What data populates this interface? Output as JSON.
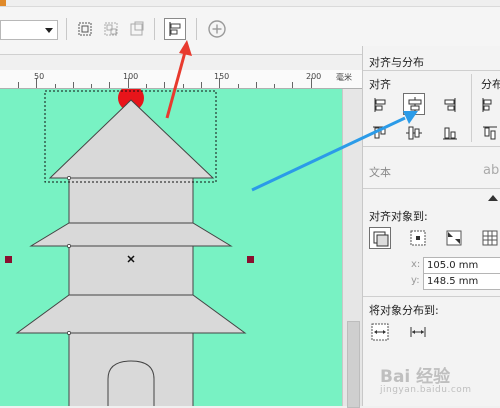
{
  "ruler": {
    "labels": [
      "50",
      "100",
      "150",
      "200"
    ],
    "unit": "毫米"
  },
  "align_panel": {
    "title": "对齐与分布",
    "align_section": "对齐",
    "distribute_section": "分布",
    "text_section": "文本",
    "align_to_label": "对齐对象到:",
    "x_label": "x:",
    "x_value": "105.0 mm",
    "y_label": "y:",
    "y_value": "148.5 mm",
    "distribute_to_label": "将对象分布到:"
  },
  "watermark": {
    "text": "Bai 经验",
    "sub": "jingyan.baidu.com"
  },
  "colors": {
    "canvas": "#78f2c3",
    "pagoda_fill": "#d9d9d9",
    "sphere": "#e8141a",
    "handle": "#8a1030",
    "red_arrow": "#e83a2e",
    "blue_arrow": "#2b9be8"
  }
}
